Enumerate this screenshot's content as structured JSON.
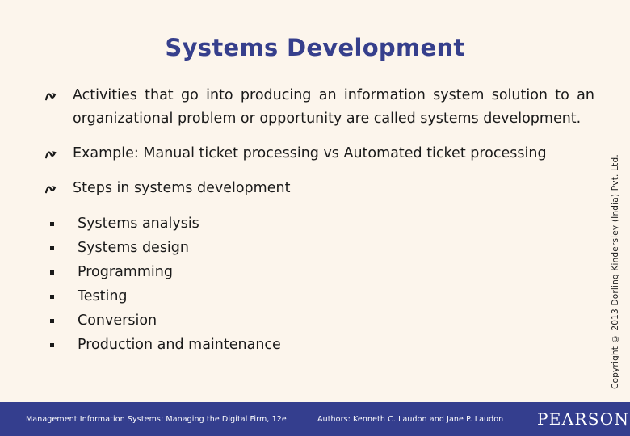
{
  "slide": {
    "title": "Systems Development",
    "background_color": "#fcf5ec",
    "title_color": "#363f8c"
  },
  "bullets": [
    {
      "marker": "wavy-arrow-icon",
      "text": "Activities that go into producing an information system solution to an organizational problem or opportunity are called systems development."
    },
    {
      "marker": "wavy-arrow-icon",
      "text": "Example: Manual ticket processing vs Automated ticket processing"
    },
    {
      "marker": "wavy-arrow-icon",
      "text": "Steps in systems development"
    }
  ],
  "sub_bullets": [
    {
      "marker": "square-bullet-icon",
      "text": "Systems analysis"
    },
    {
      "marker": "square-bullet-icon",
      "text": "Systems design"
    },
    {
      "marker": "square-bullet-icon",
      "text": "Programming"
    },
    {
      "marker": "square-bullet-icon",
      "text": "Testing"
    },
    {
      "marker": "square-bullet-icon",
      "text": "Conversion"
    },
    {
      "marker": "square-bullet-icon",
      "text": "Production and maintenance"
    }
  ],
  "copyright": {
    "text": "Copyright © 2013 Dorling Kindersley (India) Pvt. Ltd."
  },
  "footer": {
    "book_title": "Management Information Systems: Managing the Digital Firm, 12e",
    "authors": "Authors: Kenneth C. Laudon and Jane P. Laudon",
    "publisher": "PEARSON",
    "bar_color": "#343e8e",
    "text_color": "#ffffff"
  }
}
